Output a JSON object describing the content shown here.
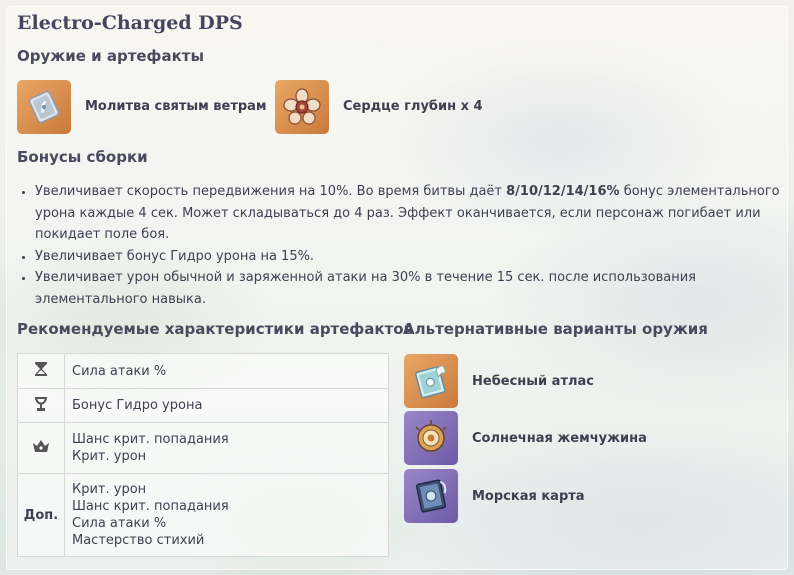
{
  "header": {
    "title": "Electro-Charged DPS"
  },
  "weapons_section": {
    "heading": "Оружие и артефакты",
    "items": [
      {
        "label": "Молитва святым ветрам",
        "icon": "artifact-set-icon"
      },
      {
        "label": "Сердце глубин x 4",
        "icon": "artifact-flower-icon"
      }
    ]
  },
  "bonus_section": {
    "heading": "Бонусы сборки",
    "items": [
      {
        "text_before": "Увеличивает скорость передвижения на 10%. Во время битвы даёт ",
        "bold": "8/10/12/14/16%",
        "text_after": " бонус элементального урона каждые 4 сек. Может складываться до 4 раз. Эффект оканчивается, если персонаж погибает или покидает поле боя."
      },
      {
        "text": "Увеличивает бонус Гидро урона на 15%."
      },
      {
        "text": "Увеличивает урон обычной и заряженной атаки на 30% в течение 15 сек. после использования элементального навыка."
      }
    ]
  },
  "stats_section": {
    "heading": "Рекомендуемые характеристики артефактов",
    "rows": [
      {
        "icon": "sands-icon",
        "values": [
          "Сила атаки %"
        ]
      },
      {
        "icon": "goblet-icon",
        "values": [
          "Бонус Гидро урона"
        ]
      },
      {
        "icon": "circlet-icon",
        "values": [
          "Шанс крит. попадания",
          "Крит. урон"
        ]
      },
      {
        "label": "Доп.",
        "values": [
          "Крит. урон",
          "Шанс крит. попадания",
          "Сила атаки %",
          "Мастерство стихий"
        ]
      }
    ]
  },
  "alt_section": {
    "heading": "Альтернативные варианты оружия",
    "items": [
      {
        "label": "Небесный атлас",
        "icon": "book-icon",
        "rarity_color": "#d58c4a"
      },
      {
        "label": "Солнечная жемчужина",
        "icon": "pearl-icon",
        "rarity_color": "#8a74bd"
      },
      {
        "label": "Морская карта",
        "icon": "map-icon",
        "rarity_color": "#8a74bd"
      }
    ]
  }
}
